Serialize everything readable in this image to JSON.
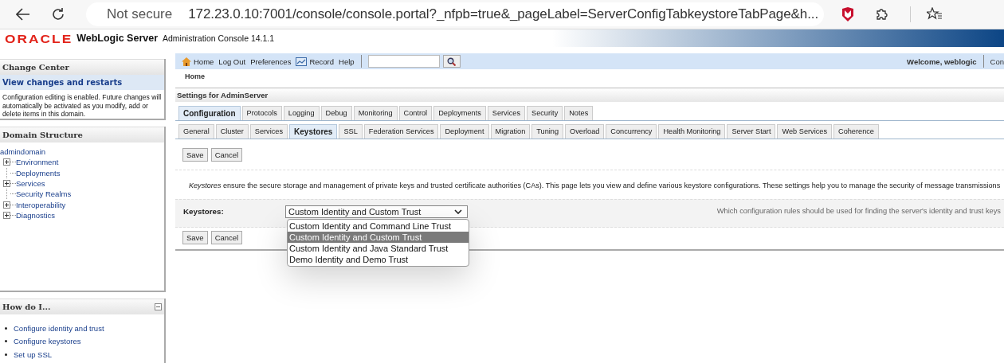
{
  "browser": {
    "security": "Not secure",
    "url": "172.23.0.10:7001/console/console.portal?_nfpb=true&_pageLabel=ServerConfigTabkeystoreTabPage&h..."
  },
  "header": {
    "logo": "ORACLE",
    "product": "WebLogic Server",
    "subtitle": "Administration Console 14.1.1"
  },
  "change_center": {
    "title": "Change Center",
    "link": "View changes and restarts",
    "text": "Configuration editing is enabled. Future changes will automatically be activated as you modify, add or delete items in this domain."
  },
  "domain_structure": {
    "title": "Domain Structure",
    "tree": [
      {
        "label": "admindomain",
        "children": [
          {
            "label": "Environment",
            "expanded": false
          },
          {
            "label": "Deployments"
          },
          {
            "label": "Services",
            "expanded": false
          },
          {
            "label": "Security Realms"
          },
          {
            "label": "Interoperability",
            "expanded": false
          },
          {
            "label": "Diagnostics",
            "expanded": false
          }
        ]
      }
    ]
  },
  "how_do_i": {
    "title": "How do I...",
    "links": [
      "Configure identity and trust",
      "Configure keystores",
      "Set up SSL"
    ]
  },
  "toolbar": {
    "links": [
      "Home",
      "Log Out",
      "Preferences",
      "Record",
      "Help"
    ],
    "welcome": "Welcome, weblogic",
    "connected": "Con"
  },
  "breadcrumb": "Home",
  "settings_title": "Settings for AdminServer",
  "tabs": [
    {
      "label": "Configuration",
      "selected": true
    },
    {
      "label": "Protocols",
      "selected": false
    },
    {
      "label": "Logging",
      "selected": false
    },
    {
      "label": "Debug",
      "selected": false
    },
    {
      "label": "Monitoring",
      "selected": false
    },
    {
      "label": "Control",
      "selected": false
    },
    {
      "label": "Deployments",
      "selected": false
    },
    {
      "label": "Services",
      "selected": false
    },
    {
      "label": "Security",
      "selected": false
    },
    {
      "label": "Notes",
      "selected": false
    }
  ],
  "subtabs": [
    {
      "label": "General",
      "selected": false
    },
    {
      "label": "Cluster",
      "selected": false
    },
    {
      "label": "Services",
      "selected": false
    },
    {
      "label": "Keystores",
      "selected": true
    },
    {
      "label": "SSL",
      "selected": false
    },
    {
      "label": "Federation Services",
      "selected": false
    },
    {
      "label": "Deployment",
      "selected": false
    },
    {
      "label": "Migration",
      "selected": false
    },
    {
      "label": "Tuning",
      "selected": false
    },
    {
      "label": "Overload",
      "selected": false
    },
    {
      "label": "Concurrency",
      "selected": false
    },
    {
      "label": "Health Monitoring",
      "selected": false
    },
    {
      "label": "Server Start",
      "selected": false
    },
    {
      "label": "Web Services",
      "selected": false
    },
    {
      "label": "Coherence",
      "selected": false
    }
  ],
  "buttons": [
    "Save",
    "Cancel"
  ],
  "description": "*Keystores* ensure the secure storage and management of private keys and trusted certificate authorities (CAs). This page lets you view and define various keystore configurations. These settings help you to manage the security of message transmissions",
  "keystores_field": {
    "label": "Keystores:",
    "value": "Custom Identity and Custom Trust",
    "hint": "Which configuration rules should be used for finding the server's identity and trust keys",
    "options": [
      {
        "label": "Custom Identity and Command Line Trust",
        "selected": false
      },
      {
        "label": "Custom Identity and Custom Trust",
        "selected": true
      },
      {
        "label": "Custom Identity and Java Standard Trust",
        "selected": false
      },
      {
        "label": "Demo Identity and Demo Trust",
        "selected": false
      }
    ]
  },
  "bottom_buttons": [
    "Save",
    "Cancel"
  ]
}
